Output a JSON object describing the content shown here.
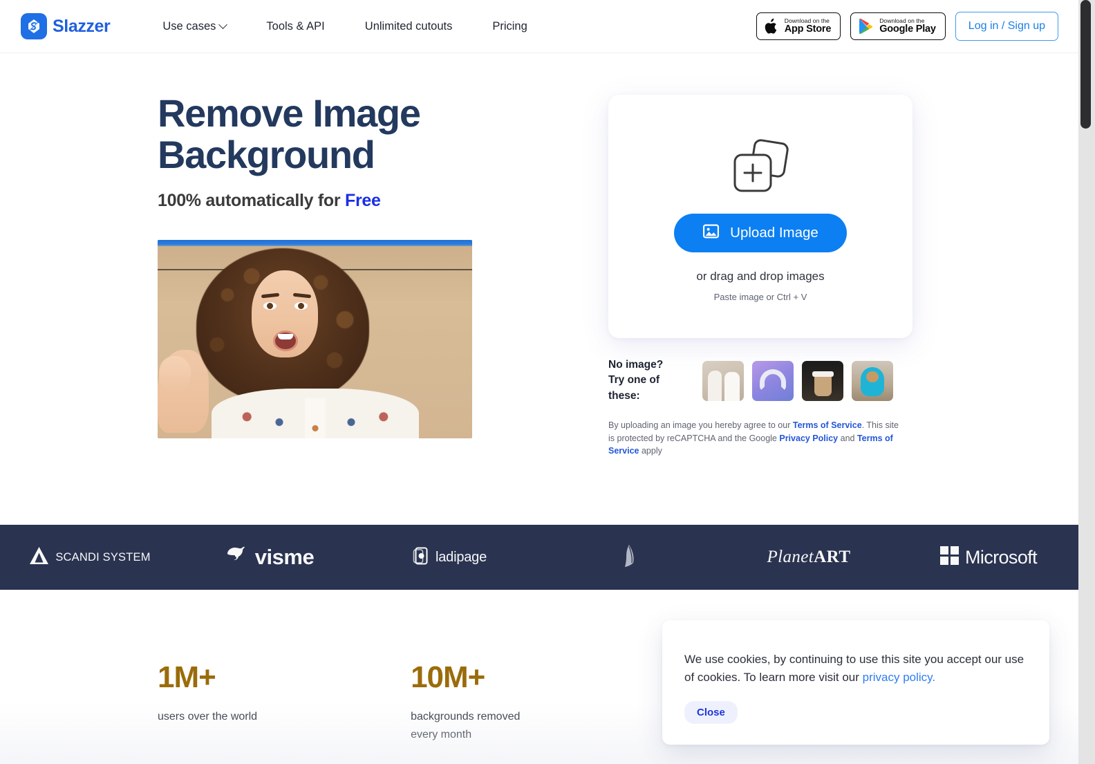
{
  "brand": {
    "name": "Slazzer",
    "accent": "#1f5fe0"
  },
  "nav": {
    "items": [
      {
        "label": "Use cases",
        "has_dropdown": true
      },
      {
        "label": "Tools & API",
        "has_dropdown": false
      },
      {
        "label": "Unlimited cutouts",
        "has_dropdown": false
      },
      {
        "label": "Pricing",
        "has_dropdown": false
      }
    ]
  },
  "header_actions": {
    "app_store": {
      "top": "Download on the",
      "bottom": "App Store",
      "icon": "apple-icon"
    },
    "google_play": {
      "top": "Download on the",
      "bottom": "Google Play",
      "icon": "google-play-icon"
    },
    "login": "Log in / Sign up"
  },
  "hero": {
    "title_line1": "Remove Image",
    "title_line2": "Background",
    "subtitle_prefix": "100% automatically for ",
    "subtitle_highlight": "Free",
    "title_color": "#23395e",
    "highlight_color": "#1a2ee6"
  },
  "upload": {
    "icon": "add-images-icon",
    "button_label": "Upload Image",
    "button_icon": "picture-icon",
    "button_color": "#0c7ff2",
    "drag_text": "or drag and drop images",
    "paste_text": "Paste image or Ctrl + V"
  },
  "samples": {
    "label_line1": "No image?",
    "label_line2": "Try one of these:",
    "thumbs": [
      {
        "name": "sample-couple"
      },
      {
        "name": "sample-headphones"
      },
      {
        "name": "sample-coffee-cup"
      },
      {
        "name": "sample-teddy-bear"
      }
    ]
  },
  "terms": {
    "part1": "By uploading an image you hereby agree to our ",
    "link1": "Terms of Service",
    "part2": ". This site is protected by reCAPTCHA and the Google ",
    "link2": "Privacy Policy",
    "part3": " and ",
    "link3": "Terms of Service",
    "part4": " apply"
  },
  "logos": {
    "background": "#2a3350",
    "items": [
      {
        "name": "scandi-system-logo",
        "text": "SCANDI SYSTEM"
      },
      {
        "name": "visme-logo",
        "text": "visme"
      },
      {
        "name": "ladipage-logo",
        "text": "ladipage"
      },
      {
        "name": "aviary-logo",
        "text": ""
      },
      {
        "name": "planetart-logo",
        "text_light": "Planet",
        "text_bold": "ART"
      },
      {
        "name": "microsoft-logo",
        "text": "Microsoft"
      }
    ]
  },
  "stats": {
    "color": "#9a6c0a",
    "items": [
      {
        "number": "1M+",
        "label": "users over the world"
      },
      {
        "number": "10M+",
        "label": "backgrounds removed every month"
      }
    ]
  },
  "cookie": {
    "text_part1": "We use cookies, by continuing to use this site you accept our use of cookies.  To learn more visit our  ",
    "link": "privacy policy.",
    "close_label": "Close"
  }
}
